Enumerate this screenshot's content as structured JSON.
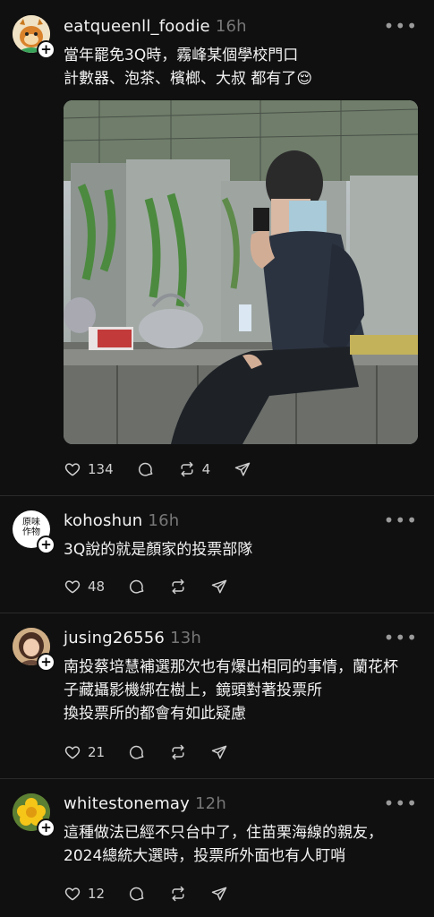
{
  "posts": [
    {
      "username": "eatqueenll_foodie",
      "time": "16h",
      "lines": [
        "當年罷免3Q時，霧峰某個學校門口",
        "計數器、泡茶、檳榔、大叔 都有了😌"
      ],
      "stats": {
        "likes": "134",
        "reposts": "4"
      }
    },
    {
      "username": "kohoshun",
      "time": "16h",
      "avatar_text": [
        "原味",
        "作物"
      ],
      "lines": [
        "3Q說的就是顏家的投票部隊"
      ],
      "stats": {
        "likes": "48"
      }
    },
    {
      "username": "jusing26556",
      "time": "13h",
      "lines": [
        "南投蔡培慧補選那次也有爆出相同的事情，蘭花杯",
        "子藏攝影機綁在樹上，鏡頭對著投票所",
        "換投票所的都會有如此疑慮"
      ],
      "stats": {
        "likes": "21"
      }
    },
    {
      "username": "whitestonemay",
      "time": "12h",
      "lines": [
        "這種做法已經不只台中了，住苗栗海線的親友，",
        "2024總統大選時，投票所外面也有人盯哨"
      ],
      "stats": {
        "likes": "12"
      }
    }
  ],
  "icons": {
    "like": "heart-icon",
    "comment": "comment-icon",
    "repost": "repost-icon",
    "share": "send-icon",
    "more": "more-icon",
    "follow": "plus-icon"
  },
  "colors": {
    "background": "#101010",
    "text": "#f3f3f3",
    "muted": "#777777"
  }
}
